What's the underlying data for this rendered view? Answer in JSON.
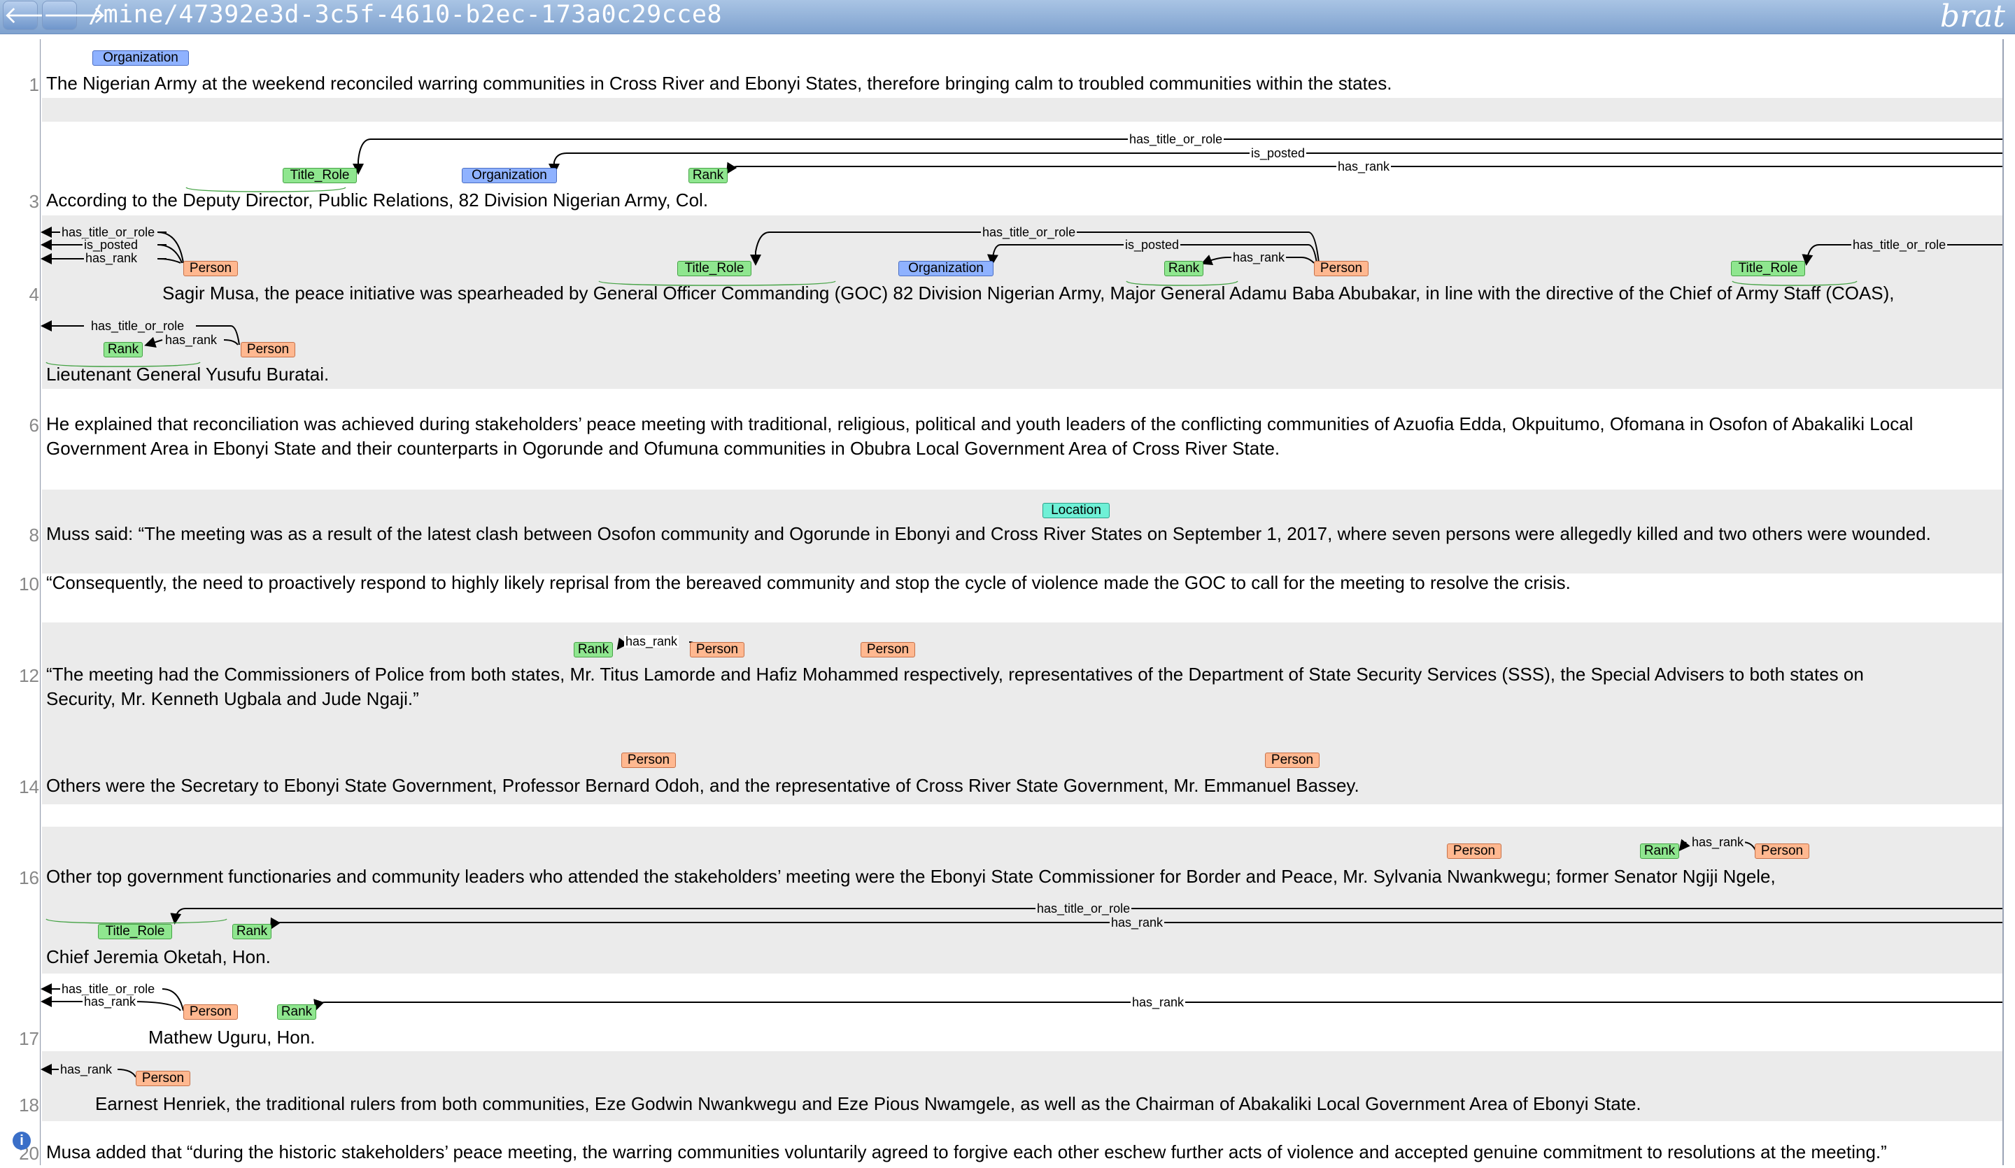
{
  "topbar": {
    "back_glyph": "🡐",
    "forward_glyph": "🡒",
    "path": "/mine/47392e3d-3c5f-4610-b2ec-173a0c29cce8",
    "brand": "brat"
  },
  "lines": {
    "1": {
      "num": "1",
      "text": "The Nigerian Army at the weekend reconciled warring communities in Cross River and Ebonyi States, therefore bringing calm to troubled communities within the states."
    },
    "3": {
      "num": "3",
      "text": "According to the Deputy Director, Public Relations, 82 Division  Nigerian Army, Col."
    },
    "4a": {
      "num": "4",
      "text": "Sagir Musa, the peace initiative was spearheaded by General Officer Commanding (GOC) 82 Division  Nigerian Army, Major General Adamu Baba Abubakar, in line with the directive of the Chief of Army Staff (COAS),"
    },
    "4b": {
      "text": "Lieutenant General Yusufu Buratai."
    },
    "6a": {
      "num": "6",
      "text": "He explained that reconciliation was achieved during stakeholders’ peace meeting with traditional, religious, political and youth leaders of the conflicting communities of Azuofia Edda, Okpuitumo, Ofomana in Osofon of Abakaliki Local"
    },
    "6b": {
      "text": "Government Area in Ebonyi State and their counterparts in Ogorunde and Ofumuna communities in Obubra Local Government Area of Cross River State."
    },
    "8": {
      "num": "8",
      "text": "Muss said: “The meeting was as a result of the latest clash between Osofon community and Ogorunde in Ebonyi and Cross River States on September 1, 2017, where seven persons were allegedly killed and two others were wounded."
    },
    "10": {
      "num": "10",
      "text": "“Consequently, the need to proactively respond to highly likely reprisal from the bereaved community and stop the cycle of violence made the GOC to call for the meeting to resolve the crisis."
    },
    "12a": {
      "num": "12",
      "text": "“The meeting had the Commissioners of Police from both states,  Mr.         Titus Lamorde and Hafiz Mohammed respectively, representatives of the Department of State Security Services (SSS), the Special Advisers to both states on"
    },
    "12b": {
      "text": "Security, Mr. Kenneth Ugbala and Jude Ngaji.”"
    },
    "14": {
      "num": "14",
      "text": "Others were the Secretary to Ebonyi State Government, Professor Bernard Odoh, and the representative of Cross River State Government, Mr. Emmanuel Bassey."
    },
    "16a": {
      "num": "16",
      "text": "Other top government functionaries and community leaders who attended the stakeholders’ meeting were the Ebonyi State Commissioner for Border and Peace, Mr. Sylvania Nwankwegu; former Senator        Ngiji Ngele,"
    },
    "16b": {
      "text": "Chief Jeremia Oketah, Hon."
    },
    "17": {
      "num": "17",
      "text": "Mathew Uguru, Hon."
    },
    "18": {
      "num": "18",
      "text": "Earnest Henriek, the traditional rulers from both communities, Eze Godwin Nwankwegu and Eze Pious Nwamgele, as well as the Chairman of Abakaliki Local Government Area of Ebonyi State."
    },
    "20": {
      "num": "20",
      "text": "Musa added that “during the historic stakeholders’ peace meeting, the warring communities voluntarily agreed to forgive each other eschew further acts of violence and accepted genuine commitment to resolutions at the meeting.”"
    }
  },
  "entity_labels": {
    "organization": "Organization",
    "title_role": "Title_Role",
    "rank": "Rank",
    "person": "Person",
    "location": "Location"
  },
  "relation_labels": {
    "has_title_or_role": "has_title_or_role",
    "is_posted": "is_posted",
    "has_rank": "has_rank"
  },
  "info_glyph": "i",
  "colors": {
    "organization": "#8fb2ff",
    "title_role": "#8fe68f",
    "rank": "#8fe68f",
    "person": "#ffb890",
    "location": "#6ff0d6",
    "topbar": "#7fa2cf"
  }
}
